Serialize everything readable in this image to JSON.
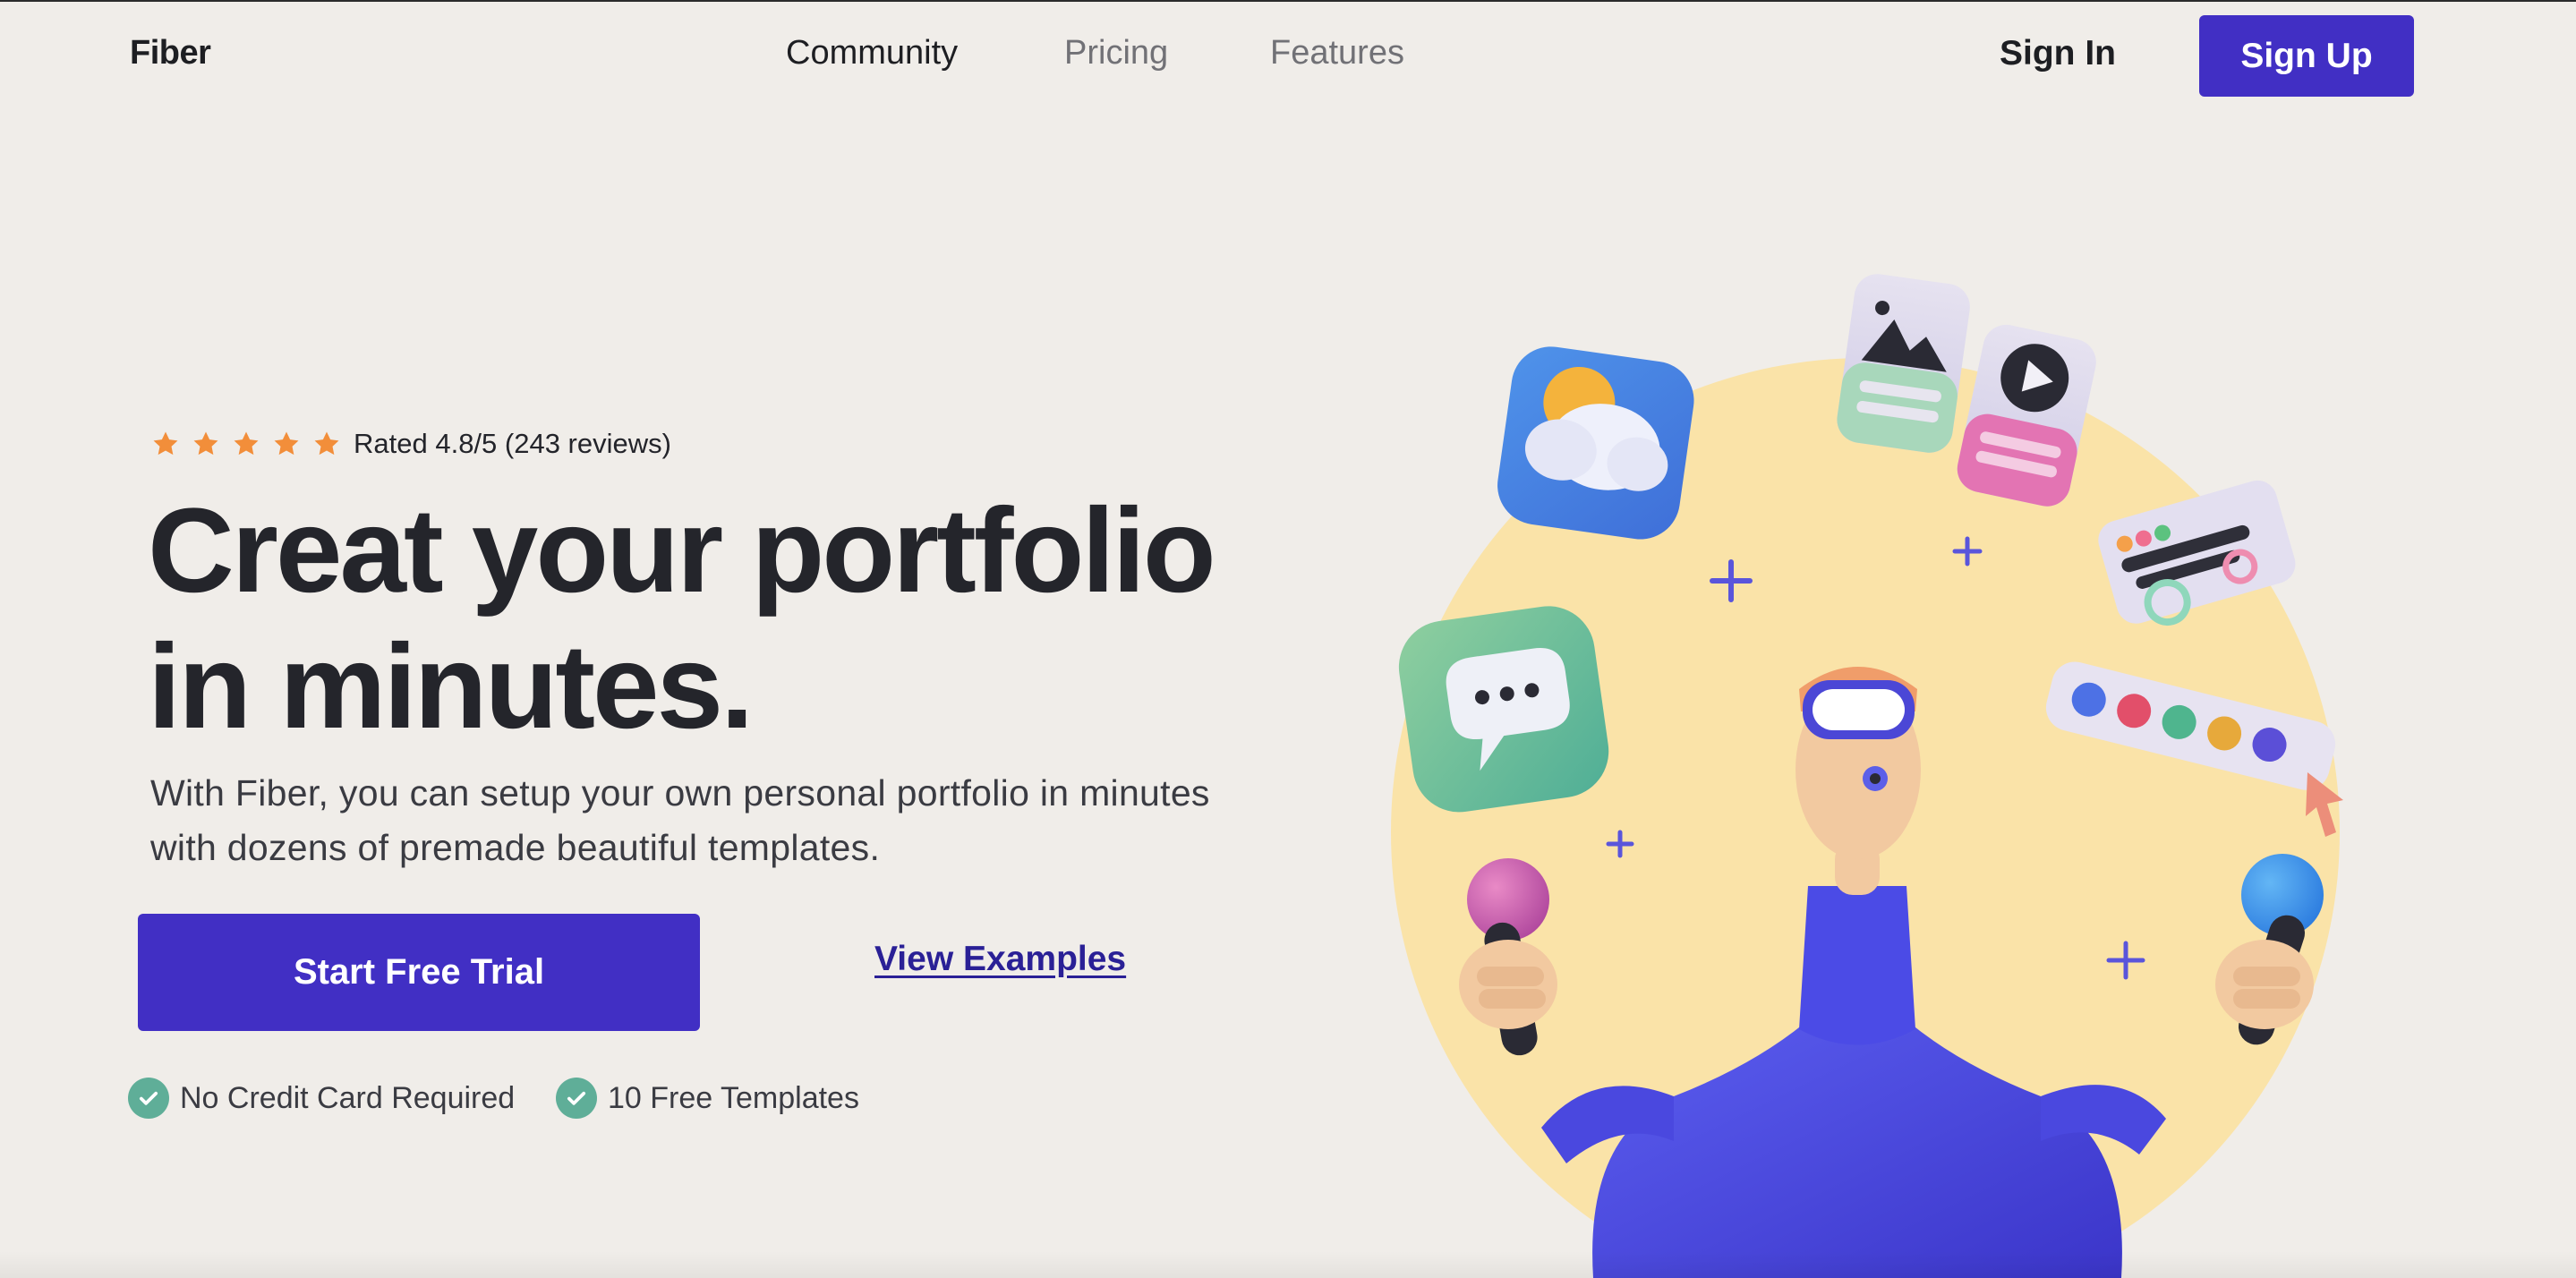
{
  "nav": {
    "brand": "Fiber",
    "links": [
      {
        "label": "Community"
      },
      {
        "label": "Pricing"
      },
      {
        "label": "Features"
      }
    ],
    "sign_in": "Sign In",
    "sign_up": "Sign Up"
  },
  "hero": {
    "rating": {
      "stars": 5,
      "text": "Rated 4.8/5 (243 reviews)",
      "star_color": "#f28e3a"
    },
    "headline_line1": "Creat your portfolio",
    "headline_line2": "in minutes.",
    "subtitle_line1": "With Fiber, you can setup your own personal portfolio in minutes",
    "subtitle_line2": "with dozens of premade beautiful templates.",
    "cta_primary": "Start Free Trial",
    "cta_secondary": "View Examples",
    "features": [
      {
        "label": "No Credit Card Required",
        "icon": "check-circle-icon"
      },
      {
        "label": "10 Free Templates",
        "icon": "check-circle-icon"
      }
    ]
  },
  "colors": {
    "background": "#f0ede9",
    "accent": "#412fc4",
    "check": "#5fae98",
    "illustration_circle": "#fae3a8"
  },
  "illustration": {
    "icons": [
      "weather-card-icon",
      "image-card-icon",
      "video-card-icon",
      "chat-bubble-icon",
      "settings-card-icon",
      "color-palette-icon",
      "cursor-icon",
      "plus-icon"
    ]
  }
}
